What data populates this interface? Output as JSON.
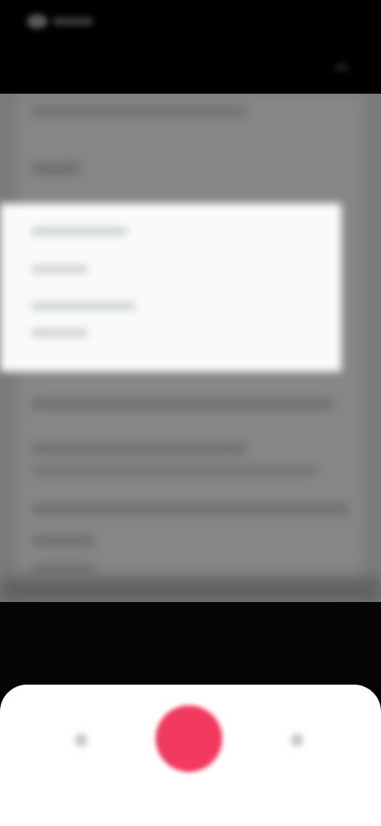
{
  "status_bar": {
    "time": ""
  },
  "top_bar": {
    "option_icon": "chevron-up-icon"
  },
  "bottom_controls": {
    "left_icon": "left-control-icon",
    "right_icon": "right-control-icon",
    "shutter_color": "#f23a5e"
  },
  "colors": {
    "background": "#000000",
    "viewfinder": "#7a7b7b",
    "panel": "#fafafa",
    "controls_bg": "#ffffff",
    "accent": "#f23a5e"
  }
}
